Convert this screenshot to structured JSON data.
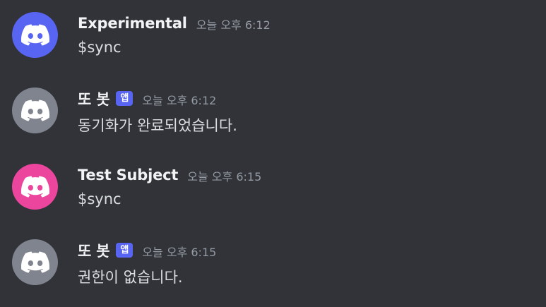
{
  "colors": {
    "background": "#313338",
    "username": "#f2f3f5",
    "message_text": "#dbdee1",
    "timestamp": "#949ba4",
    "app_badge": "#5865f2"
  },
  "messages": [
    {
      "author": "Experimental",
      "timestamp": "오늘 오후 6:12",
      "content": "$sync",
      "avatar_icon": "discord-logo-icon",
      "avatar_color": "#5865f2"
    },
    {
      "author": "또 봇",
      "badge": "앱",
      "timestamp": "오늘 오후 6:12",
      "content": "동기화가 완료되었습니다.",
      "avatar_icon": "discord-logo-icon",
      "avatar_color": "#80848e"
    },
    {
      "author": "Test Subject",
      "timestamp": "오늘 오후 6:15",
      "content": "$sync",
      "avatar_icon": "discord-logo-icon",
      "avatar_color": "#eb459e"
    },
    {
      "author": "또 봇",
      "badge": "앱",
      "timestamp": "오늘 오후 6:15",
      "content": "권한이 없습니다.",
      "avatar_icon": "discord-logo-icon",
      "avatar_color": "#80848e"
    }
  ]
}
